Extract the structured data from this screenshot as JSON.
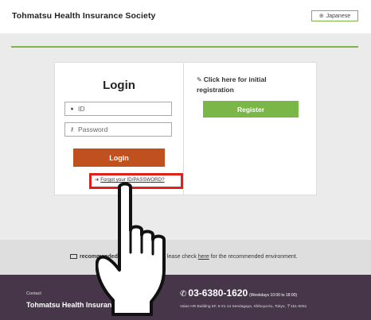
{
  "header": {
    "title": "Tohmatsu Health Insurance Society",
    "language_button": "Japanese"
  },
  "login": {
    "title": "Login",
    "id_placeholder": "ID",
    "password_placeholder": "Password",
    "button_label": "Login",
    "forgot_link": "Forgot your ID/PASSWORD?"
  },
  "registration": {
    "hint": "Click here for initial registration",
    "button_label": "Register"
  },
  "environment": {
    "label": "recommended",
    "text_before_link": "lease check ",
    "link": "here",
    "text_after_link": " for the recommended environment."
  },
  "footer": {
    "contact_label": "Contact",
    "organization": "Tohmatsu Health Insurance Society",
    "phone": "03-6380-1620",
    "hours": "(Weekdays 10:00 to 18:00)",
    "address": "Value HR Building 5F, 5-21-14 Sendagaya, Shibuya-ku, Tokyo, 〒151-0051"
  },
  "colors": {
    "accent_green": "#7ab648",
    "login_orange": "#c0501d",
    "highlight_red": "#e0201a",
    "footer_purple": "#47364a"
  },
  "icons": [
    "globe-icon",
    "user-icon",
    "key-icon",
    "edit-icon",
    "arrow-right-icon",
    "monitor-icon",
    "phone-icon",
    "pointing-hand-icon"
  ]
}
